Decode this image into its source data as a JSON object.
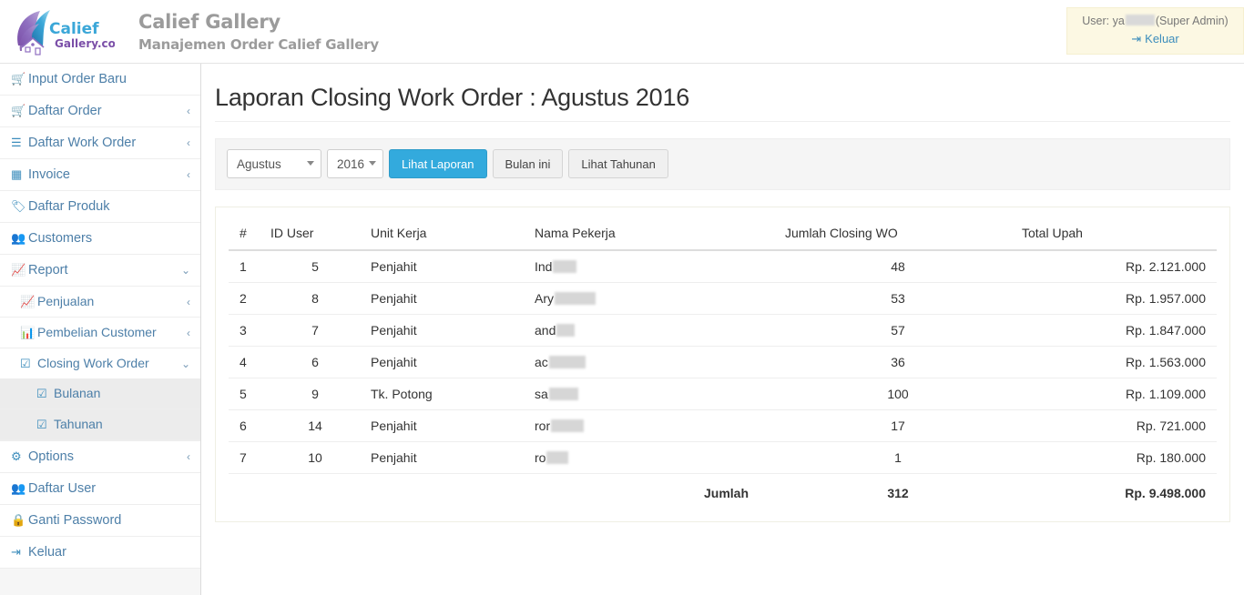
{
  "header": {
    "brand_title": "Calief Gallery",
    "brand_subtitle": "Manajemen Order Calief Gallery",
    "logo_primary_text": "Calief",
    "logo_secondary_text": "Gallery.com",
    "user_prefix": "User: ya",
    "user_role": "(Super Admin)",
    "logout_label": "Keluar",
    "logout_icon": "sign-out-icon",
    "userbox_bg": "#fcf8e3",
    "brand_color": "#9b9b9b"
  },
  "sidebar": {
    "items": [
      {
        "label": "Input Order Baru",
        "icon": "cart-plus-icon",
        "arrow": ""
      },
      {
        "label": "Daftar Order",
        "icon": "cart-icon",
        "arrow": "‹"
      },
      {
        "label": "Daftar Work Order",
        "icon": "list-icon",
        "arrow": "‹"
      },
      {
        "label": "Invoice",
        "icon": "money-icon",
        "arrow": "‹"
      },
      {
        "label": "Daftar Produk",
        "icon": "tag-icon",
        "arrow": ""
      },
      {
        "label": "Customers",
        "icon": "users-icon",
        "arrow": ""
      },
      {
        "label": "Report",
        "icon": "line-chart-icon",
        "arrow": "⌄"
      }
    ],
    "report_children": [
      {
        "label": "Penjualan",
        "icon": "line-chart-icon",
        "arrow": "‹"
      },
      {
        "label": "Pembelian Customer",
        "icon": "bar-chart-icon",
        "arrow": "‹"
      },
      {
        "label": "Closing Work Order",
        "icon": "check-square-icon",
        "arrow": "⌄"
      }
    ],
    "closing_children": [
      {
        "label": "Bulanan",
        "icon": "check-square-icon"
      },
      {
        "label": "Tahunan",
        "icon": "check-square-icon"
      }
    ],
    "bottom_items": [
      {
        "label": "Options",
        "icon": "gears-icon",
        "arrow": "‹"
      },
      {
        "label": "Daftar User",
        "icon": "users-icon",
        "arrow": ""
      },
      {
        "label": "Ganti Password",
        "icon": "lock-icon",
        "arrow": ""
      },
      {
        "label": "Keluar",
        "icon": "sign-out-icon",
        "arrow": ""
      }
    ],
    "link_color": "#4d7fa8",
    "active_group_bg": "#ececec"
  },
  "main": {
    "page_title": "Laporan Closing Work Order : Agustus 2016",
    "filters": {
      "month_value": "Agustus",
      "year_value": "2016",
      "submit_label": "Lihat Laporan",
      "this_month_label": "Bulan ini",
      "yearly_label": "Lihat Tahunan",
      "primary_color": "#33aadd"
    },
    "table": {
      "columns": [
        "#",
        "ID User",
        "Unit Kerja",
        "Nama Pekerja",
        "Jumlah Closing WO",
        "Total Upah"
      ],
      "rows": [
        {
          "no": "1",
          "id_user": "5",
          "unit": "Penjahit",
          "nama_visible": "Ind",
          "redact_width": 26,
          "jumlah": "48",
          "upah": "Rp. 2.121.000"
        },
        {
          "no": "2",
          "id_user": "8",
          "unit": "Penjahit",
          "nama_visible": "Ary",
          "redact_width": 45,
          "jumlah": "53",
          "upah": "Rp. 1.957.000"
        },
        {
          "no": "3",
          "id_user": "7",
          "unit": "Penjahit",
          "nama_visible": "and",
          "redact_width": 20,
          "jumlah": "57",
          "upah": "Rp. 1.847.000"
        },
        {
          "no": "4",
          "id_user": "6",
          "unit": "Penjahit",
          "nama_visible": "ac",
          "redact_width": 40,
          "jumlah": "36",
          "upah": "Rp. 1.563.000"
        },
        {
          "no": "5",
          "id_user": "9",
          "unit": "Tk. Potong",
          "nama_visible": "sa",
          "redact_width": 32,
          "jumlah": "100",
          "upah": "Rp. 1.109.000"
        },
        {
          "no": "6",
          "id_user": "14",
          "unit": "Penjahit",
          "nama_visible": "ror",
          "redact_width": 36,
          "jumlah": "17",
          "upah": "Rp. 721.000"
        },
        {
          "no": "7",
          "id_user": "10",
          "unit": "Penjahit",
          "nama_visible": "ro",
          "redact_width": 24,
          "jumlah": "1",
          "upah": "Rp. 180.000"
        }
      ],
      "total_label": "Jumlah",
      "total_jumlah": "312",
      "total_upah": "Rp. 9.498.000"
    }
  }
}
